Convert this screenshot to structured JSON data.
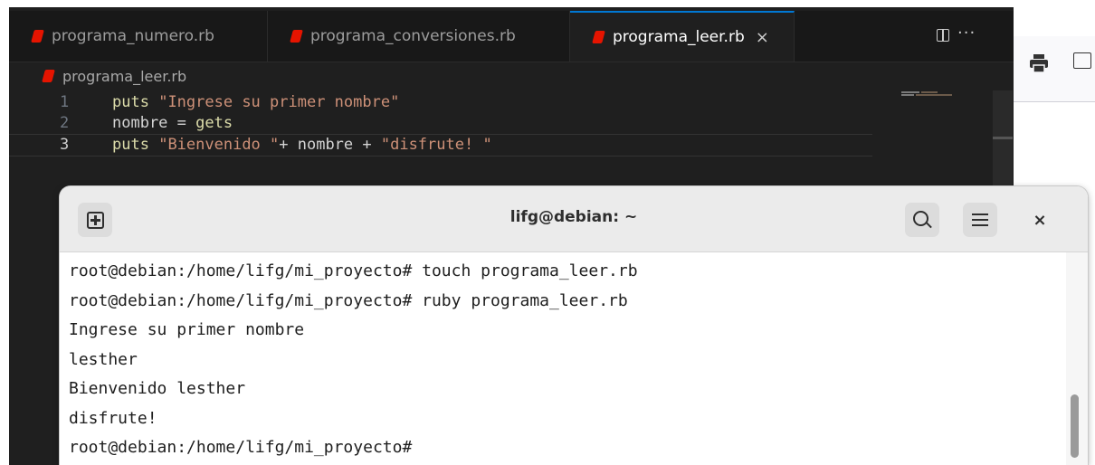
{
  "editor": {
    "tabs": [
      {
        "label": "programa_numero.rb",
        "active": false
      },
      {
        "label": "programa_conversiones.rb",
        "active": false
      },
      {
        "label": "programa_leer.rb",
        "active": true
      }
    ],
    "close_glyph": "×",
    "more_glyph": "···",
    "breadcrumb": "programa_leer.rb",
    "lines": [
      {
        "number": "1",
        "tokens": [
          [
            "kw",
            "puts"
          ],
          [
            "plain",
            " "
          ],
          [
            "str",
            "\"Ingrese su primer nombre\""
          ]
        ]
      },
      {
        "number": "2",
        "tokens": [
          [
            "plain",
            "nombre = "
          ],
          [
            "kw",
            "gets"
          ]
        ]
      },
      {
        "number": "3",
        "tokens": [
          [
            "kw",
            "puts"
          ],
          [
            "plain",
            " "
          ],
          [
            "str",
            "\"Bienvenido \""
          ],
          [
            "plain",
            "+ nombre + "
          ],
          [
            "str",
            "\"disfrute! \""
          ]
        ]
      }
    ],
    "colors": {
      "ruby_icon": "#e51400",
      "accent": "#0078d4",
      "keyword": "#dcdcaa",
      "string": "#ce9178"
    }
  },
  "terminal": {
    "title": "lifg@debian: ~",
    "close_glyph": "×",
    "lines": [
      "root@debian:/home/lifg/mi_proyecto# touch programa_leer.rb",
      "root@debian:/home/lifg/mi_proyecto# ruby programa_leer.rb",
      "Ingrese su primer nombre",
      "lesther",
      "Bienvenido lesther",
      "disfrute!",
      "root@debian:/home/lifg/mi_proyecto#"
    ]
  },
  "icons": {
    "new_tab": "new-tab-icon",
    "search": "search-icon",
    "menu": "hamburger-menu-icon",
    "print": "print-icon",
    "save": "save-icon",
    "split": "split-editor-icon"
  }
}
